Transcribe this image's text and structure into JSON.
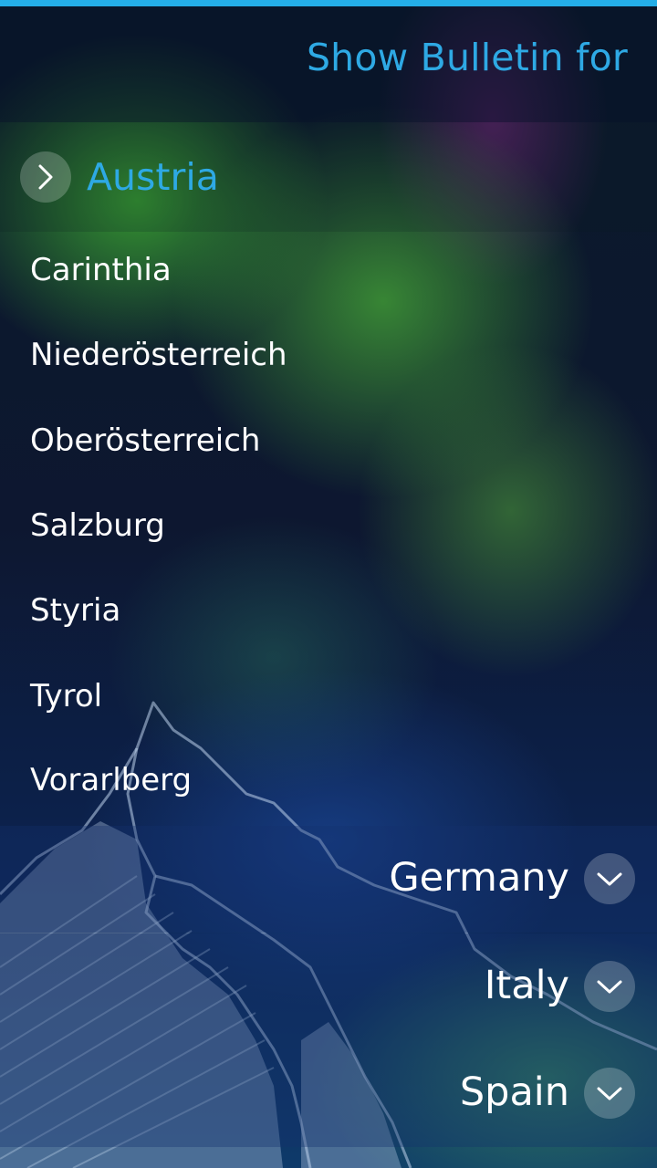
{
  "header": {
    "title": "Show Bulletin for"
  },
  "expanded_country": {
    "label": "Austria",
    "icon": "chevron-right-icon"
  },
  "regions": [
    {
      "label": "Carinthia"
    },
    {
      "label": "Niederösterreich"
    },
    {
      "label": "Oberösterreich"
    },
    {
      "label": "Salzburg"
    },
    {
      "label": "Styria"
    },
    {
      "label": "Tyrol"
    },
    {
      "label": "Vorarlberg"
    }
  ],
  "collapsed_countries": [
    {
      "label": "Germany",
      "icon": "chevron-down-icon"
    },
    {
      "label": "Italy",
      "icon": "chevron-down-icon"
    },
    {
      "label": "Spain",
      "icon": "chevron-down-icon"
    }
  ],
  "colors": {
    "accent": "#2ea9e4",
    "top_bar": "#24aee8",
    "text": "#ffffff"
  }
}
